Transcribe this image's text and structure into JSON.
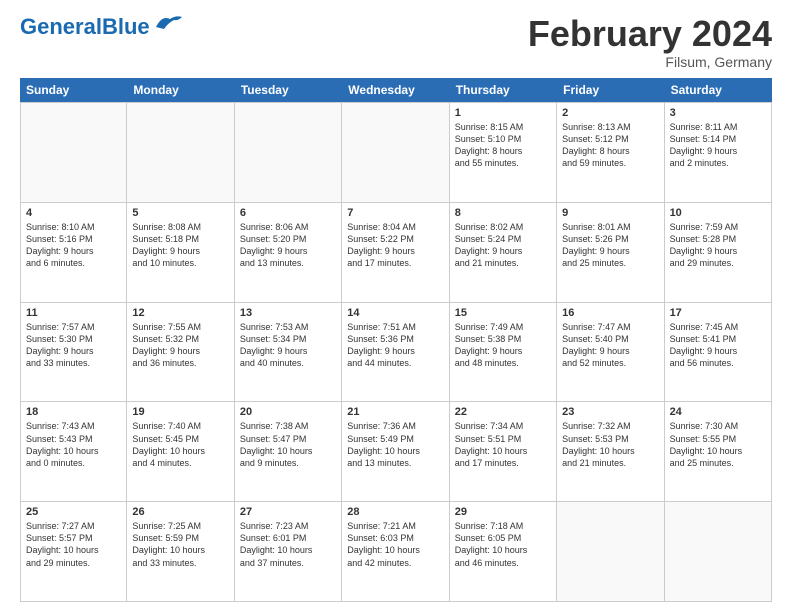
{
  "header": {
    "logo_main": "General",
    "logo_accent": "Blue",
    "month": "February 2024",
    "location": "Filsum, Germany"
  },
  "days_of_week": [
    "Sunday",
    "Monday",
    "Tuesday",
    "Wednesday",
    "Thursday",
    "Friday",
    "Saturday"
  ],
  "weeks": [
    [
      {
        "day": "",
        "info": ""
      },
      {
        "day": "",
        "info": ""
      },
      {
        "day": "",
        "info": ""
      },
      {
        "day": "",
        "info": ""
      },
      {
        "day": "1",
        "info": "Sunrise: 8:15 AM\nSunset: 5:10 PM\nDaylight: 8 hours\nand 55 minutes."
      },
      {
        "day": "2",
        "info": "Sunrise: 8:13 AM\nSunset: 5:12 PM\nDaylight: 8 hours\nand 59 minutes."
      },
      {
        "day": "3",
        "info": "Sunrise: 8:11 AM\nSunset: 5:14 PM\nDaylight: 9 hours\nand 2 minutes."
      }
    ],
    [
      {
        "day": "4",
        "info": "Sunrise: 8:10 AM\nSunset: 5:16 PM\nDaylight: 9 hours\nand 6 minutes."
      },
      {
        "day": "5",
        "info": "Sunrise: 8:08 AM\nSunset: 5:18 PM\nDaylight: 9 hours\nand 10 minutes."
      },
      {
        "day": "6",
        "info": "Sunrise: 8:06 AM\nSunset: 5:20 PM\nDaylight: 9 hours\nand 13 minutes."
      },
      {
        "day": "7",
        "info": "Sunrise: 8:04 AM\nSunset: 5:22 PM\nDaylight: 9 hours\nand 17 minutes."
      },
      {
        "day": "8",
        "info": "Sunrise: 8:02 AM\nSunset: 5:24 PM\nDaylight: 9 hours\nand 21 minutes."
      },
      {
        "day": "9",
        "info": "Sunrise: 8:01 AM\nSunset: 5:26 PM\nDaylight: 9 hours\nand 25 minutes."
      },
      {
        "day": "10",
        "info": "Sunrise: 7:59 AM\nSunset: 5:28 PM\nDaylight: 9 hours\nand 29 minutes."
      }
    ],
    [
      {
        "day": "11",
        "info": "Sunrise: 7:57 AM\nSunset: 5:30 PM\nDaylight: 9 hours\nand 33 minutes."
      },
      {
        "day": "12",
        "info": "Sunrise: 7:55 AM\nSunset: 5:32 PM\nDaylight: 9 hours\nand 36 minutes."
      },
      {
        "day": "13",
        "info": "Sunrise: 7:53 AM\nSunset: 5:34 PM\nDaylight: 9 hours\nand 40 minutes."
      },
      {
        "day": "14",
        "info": "Sunrise: 7:51 AM\nSunset: 5:36 PM\nDaylight: 9 hours\nand 44 minutes."
      },
      {
        "day": "15",
        "info": "Sunrise: 7:49 AM\nSunset: 5:38 PM\nDaylight: 9 hours\nand 48 minutes."
      },
      {
        "day": "16",
        "info": "Sunrise: 7:47 AM\nSunset: 5:40 PM\nDaylight: 9 hours\nand 52 minutes."
      },
      {
        "day": "17",
        "info": "Sunrise: 7:45 AM\nSunset: 5:41 PM\nDaylight: 9 hours\nand 56 minutes."
      }
    ],
    [
      {
        "day": "18",
        "info": "Sunrise: 7:43 AM\nSunset: 5:43 PM\nDaylight: 10 hours\nand 0 minutes."
      },
      {
        "day": "19",
        "info": "Sunrise: 7:40 AM\nSunset: 5:45 PM\nDaylight: 10 hours\nand 4 minutes."
      },
      {
        "day": "20",
        "info": "Sunrise: 7:38 AM\nSunset: 5:47 PM\nDaylight: 10 hours\nand 9 minutes."
      },
      {
        "day": "21",
        "info": "Sunrise: 7:36 AM\nSunset: 5:49 PM\nDaylight: 10 hours\nand 13 minutes."
      },
      {
        "day": "22",
        "info": "Sunrise: 7:34 AM\nSunset: 5:51 PM\nDaylight: 10 hours\nand 17 minutes."
      },
      {
        "day": "23",
        "info": "Sunrise: 7:32 AM\nSunset: 5:53 PM\nDaylight: 10 hours\nand 21 minutes."
      },
      {
        "day": "24",
        "info": "Sunrise: 7:30 AM\nSunset: 5:55 PM\nDaylight: 10 hours\nand 25 minutes."
      }
    ],
    [
      {
        "day": "25",
        "info": "Sunrise: 7:27 AM\nSunset: 5:57 PM\nDaylight: 10 hours\nand 29 minutes."
      },
      {
        "day": "26",
        "info": "Sunrise: 7:25 AM\nSunset: 5:59 PM\nDaylight: 10 hours\nand 33 minutes."
      },
      {
        "day": "27",
        "info": "Sunrise: 7:23 AM\nSunset: 6:01 PM\nDaylight: 10 hours\nand 37 minutes."
      },
      {
        "day": "28",
        "info": "Sunrise: 7:21 AM\nSunset: 6:03 PM\nDaylight: 10 hours\nand 42 minutes."
      },
      {
        "day": "29",
        "info": "Sunrise: 7:18 AM\nSunset: 6:05 PM\nDaylight: 10 hours\nand 46 minutes."
      },
      {
        "day": "",
        "info": ""
      },
      {
        "day": "",
        "info": ""
      }
    ]
  ]
}
